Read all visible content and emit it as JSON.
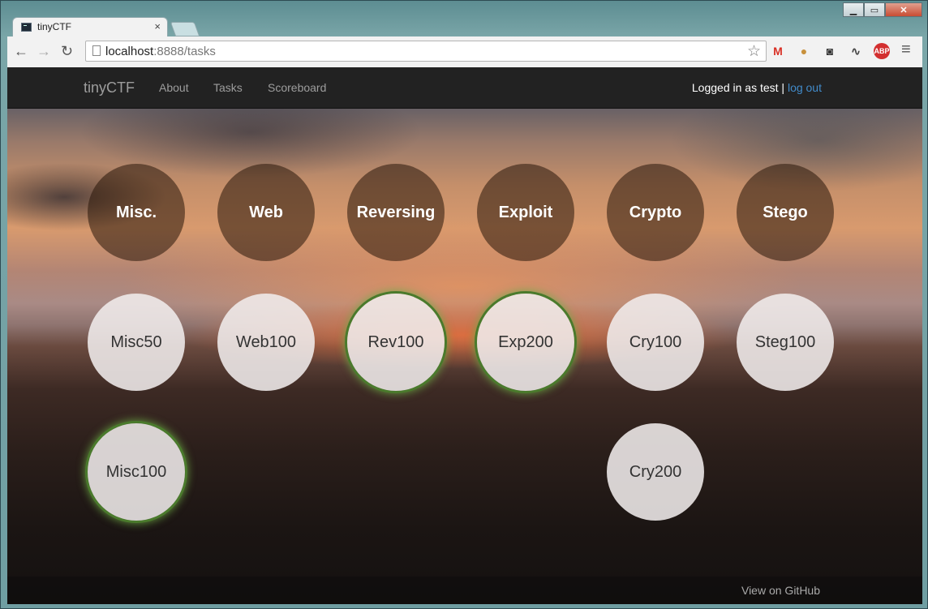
{
  "browser": {
    "tab_title": "tinyCTF",
    "tab_close": "×",
    "url_host": "localhost",
    "url_path": ":8888/tasks",
    "window_buttons": {
      "minimize": "▁",
      "maximize": "▭",
      "close": "✕"
    },
    "nav": {
      "back": "←",
      "forward": "→",
      "reload": "↻"
    },
    "star": "☆",
    "extensions": [
      {
        "name": "gmail-icon",
        "glyph": "M",
        "color": "#d93025"
      },
      {
        "name": "cookie-icon",
        "glyph": "●",
        "color": "#c8913c"
      },
      {
        "name": "incognito-icon",
        "glyph": "◙",
        "color": "#333333"
      },
      {
        "name": "pulse-icon",
        "glyph": "∿",
        "color": "#444444"
      },
      {
        "name": "adblock-icon",
        "glyph": "ABP",
        "color": "#d32f2f"
      }
    ],
    "menu": "≡"
  },
  "navbar": {
    "brand": "tinyCTF",
    "links": [
      "About",
      "Tasks",
      "Scoreboard"
    ],
    "logged_in_text": "Logged in as test | ",
    "logout": "log out"
  },
  "categories": [
    "Misc.",
    "Web",
    "Reversing",
    "Exploit",
    "Crypto",
    "Stego"
  ],
  "tasks": [
    {
      "label": "Misc50",
      "solved": false
    },
    {
      "label": "Web100",
      "solved": false
    },
    {
      "label": "Rev100",
      "solved": true
    },
    {
      "label": "Exp200",
      "solved": true
    },
    {
      "label": "Cry100",
      "solved": false
    },
    {
      "label": "Steg100",
      "solved": false
    },
    {
      "label": "Misc100",
      "solved": true
    },
    {
      "label": "Cry200",
      "solved": false
    }
  ],
  "footer": {
    "github": "View on GitHub"
  }
}
